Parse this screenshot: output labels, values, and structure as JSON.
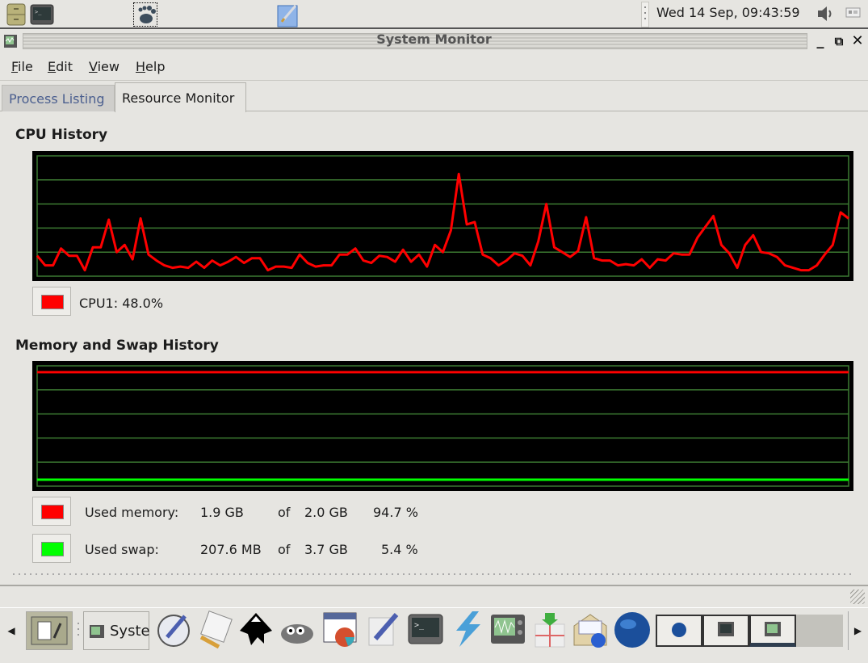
{
  "top_panel": {
    "icons": [
      "file-cabinet-icon",
      "terminal-icon",
      "gnome-foot-menu-icon",
      "text-editor-icon"
    ],
    "clock": "Wed 14 Sep, 09:43:59",
    "volume_icon": "speaker-icon",
    "keyboard_icon": "keyboard-indicator-icon"
  },
  "window": {
    "title": "System Monitor",
    "controls": {
      "minimize": "_",
      "maximize": "⧉",
      "close": "✕"
    }
  },
  "menubar": [
    {
      "label": "File",
      "mnemonic": "F",
      "rest": "ile"
    },
    {
      "label": "Edit",
      "mnemonic": "E",
      "rest": "dit"
    },
    {
      "label": "View",
      "mnemonic": "V",
      "rest": "iew"
    },
    {
      "label": "Help",
      "mnemonic": "H",
      "rest": "elp"
    }
  ],
  "tabs": [
    {
      "label": "Process Listing",
      "active": false
    },
    {
      "label": "Resource Monitor",
      "active": true
    }
  ],
  "cpu": {
    "title": "CPU History",
    "legend": {
      "label": "CPU1: 48.0%",
      "color": "#ff0000"
    }
  },
  "memory": {
    "title": "Memory and Swap History",
    "rows": [
      {
        "name": "Used memory:",
        "used": "1.9 GB",
        "of": "of",
        "total": "2.0 GB",
        "percent": "94.7 %",
        "color": "#ff0000"
      },
      {
        "name": "Used swap:",
        "used": "207.6 MB",
        "of": "of",
        "total": "3.7 GB",
        "percent": "5.4 %",
        "color": "#00ff00"
      }
    ]
  },
  "taskbar": {
    "task_label": "Syste",
    "launchers": [
      "scroll-left-icon",
      "show-desktop-icon",
      "system-monitor-task-icon",
      "quill-icon",
      "notepad-icon",
      "inkscape-icon",
      "gimp-icon",
      "spreadsheet-icon",
      "drawing-pen-icon",
      "terminal-icon",
      "lightning-icon",
      "oscilloscope-icon",
      "network-icon",
      "mail-icon",
      "web-browser-icon"
    ],
    "workspaces": 4
  },
  "chart_data": [
    {
      "type": "line",
      "title": "CPU History",
      "ylim": [
        0,
        100
      ],
      "grid": true,
      "gridlines": 5,
      "series": [
        {
          "name": "CPU1",
          "color": "#ff0000",
          "values": [
            17,
            9,
            9,
            23,
            17,
            17,
            5,
            24,
            24,
            47,
            20,
            26,
            14,
            48,
            18,
            13,
            9,
            7,
            8,
            7,
            12,
            7,
            13,
            9,
            12,
            16,
            11,
            15,
            15,
            5,
            8,
            8,
            7,
            18,
            11,
            8,
            9,
            9,
            18,
            18,
            23,
            13,
            11,
            17,
            16,
            12,
            22,
            12,
            18,
            8,
            26,
            20,
            38,
            85,
            43,
            45,
            18,
            15,
            9,
            13,
            19,
            17,
            9,
            29,
            60,
            24,
            20,
            16,
            21,
            49,
            15,
            13,
            13,
            9,
            10,
            9,
            14,
            7,
            14,
            13,
            19,
            18,
            18,
            32,
            41,
            50,
            26,
            19,
            7,
            26,
            34,
            20,
            19,
            16,
            9,
            7,
            5,
            5,
            9,
            18,
            26,
            53,
            48
          ]
        }
      ]
    },
    {
      "type": "line",
      "title": "Memory and Swap History",
      "ylim": [
        0,
        100
      ],
      "grid": true,
      "gridlines": 5,
      "series": [
        {
          "name": "Used memory",
          "color": "#ff0000",
          "values": [
            94.7,
            94.7
          ]
        },
        {
          "name": "Used swap",
          "color": "#00ff00",
          "values": [
            5.4,
            5.4
          ]
        }
      ]
    }
  ]
}
